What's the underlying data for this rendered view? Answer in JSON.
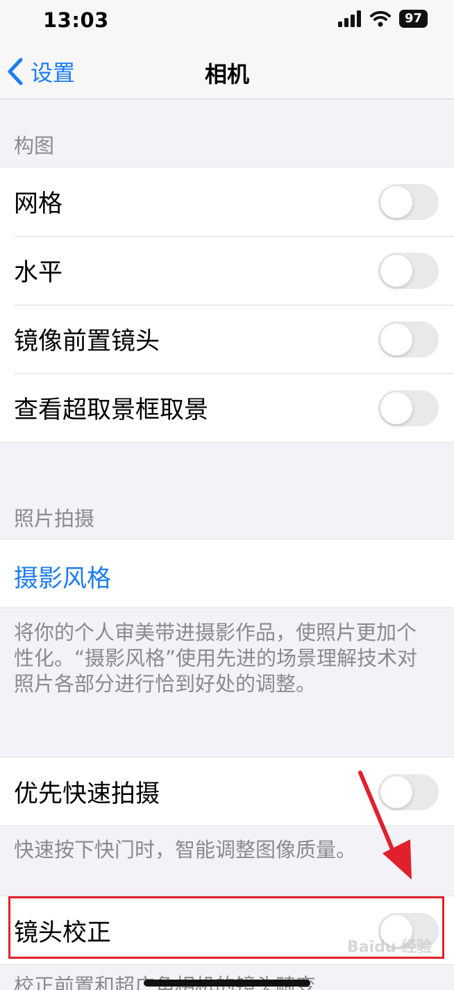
{
  "status_bar": {
    "time": "13:03",
    "battery": "97"
  },
  "nav": {
    "back_label": "设置",
    "title": "相机"
  },
  "composition": {
    "header": "构图",
    "items": [
      {
        "label": "网格",
        "on": false
      },
      {
        "label": "水平",
        "on": false
      },
      {
        "label": "镜像前置镜头",
        "on": false
      },
      {
        "label": "查看超取景框取景",
        "on": false
      }
    ]
  },
  "photo_capture": {
    "header": "照片拍摄",
    "styles_label": "摄影风格",
    "styles_footer": "将你的个人审美带进摄影作品，使照片更加个性化。“摄影风格”使用先进的场景理解技术对照片各部分进行恰到好处的调整。"
  },
  "prioritize": {
    "label": "优先快速拍摄",
    "on": false,
    "footer": "快速按下快门时，智能调整图像质量。"
  },
  "lens_correction": {
    "label": "镜头校正",
    "on": false,
    "footer_partial": "校正前置和超广角相机的镜头畸变"
  },
  "watermark": "Baidu 经验",
  "colors": {
    "accent": "#1a7cf5",
    "highlight": "#e0202b"
  }
}
